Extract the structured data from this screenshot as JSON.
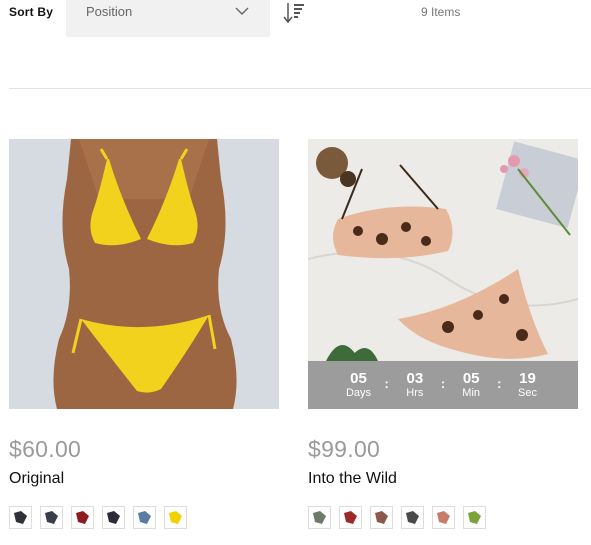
{
  "toolbar": {
    "sort_label": "Sort By",
    "sort_value": "Position",
    "item_count": "9 Items"
  },
  "products": [
    {
      "price": "$60.00",
      "name": "Original",
      "swatch_colors": [
        "#2f3138",
        "#3a3d4a",
        "#8e1b1f",
        "#2e2b38",
        "#5a7ea3",
        "#f1d200"
      ]
    },
    {
      "price": "$99.00",
      "name": "Into the Wild",
      "countdown": {
        "days": "05",
        "days_label": "Days",
        "hrs": "03",
        "hrs_label": "Hrs",
        "min": "05",
        "min_label": "Min",
        "sec": "19",
        "sec_label": "Sec"
      },
      "swatch_colors": [
        "#6d7a6a",
        "#9b2a2a",
        "#8a5a4a",
        "#4a4a4a",
        "#c77b6a",
        "#7aa33a"
      ]
    }
  ],
  "icons": {
    "sort_select_chevron": "chevron-down-icon",
    "sort_direction": "sort-descending-icon"
  }
}
